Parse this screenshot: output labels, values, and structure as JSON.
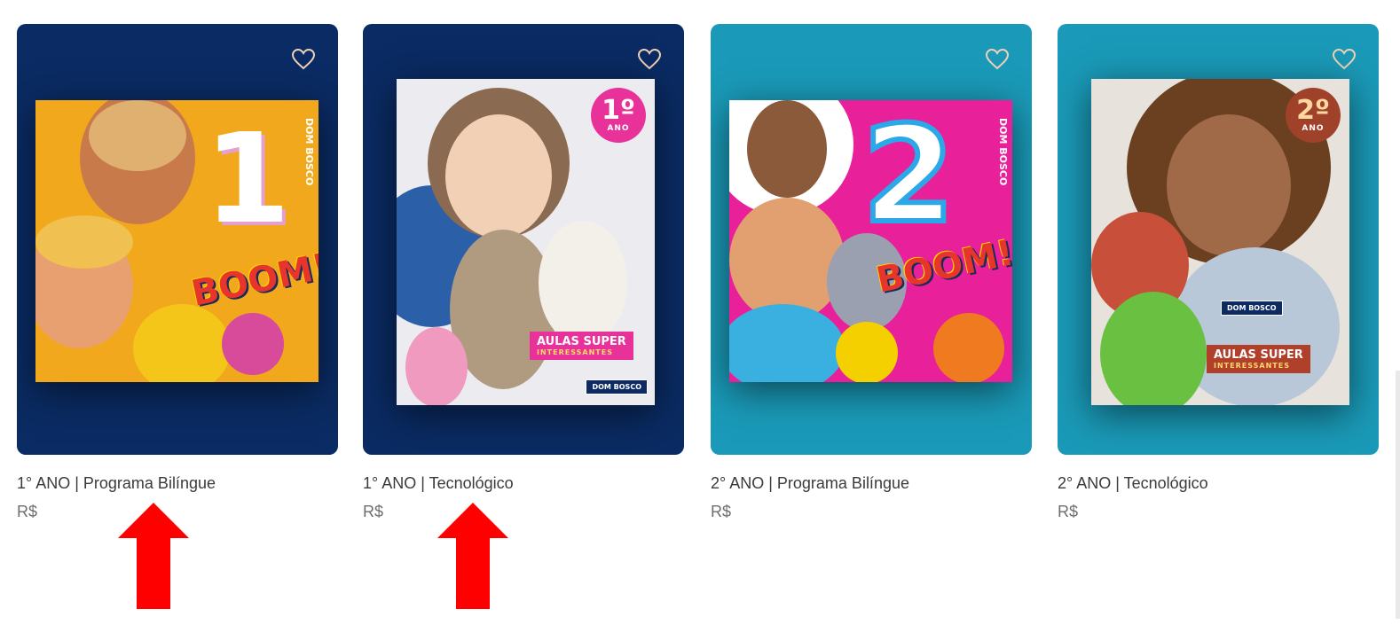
{
  "products": [
    {
      "title": "1° ANO | Programa Bilíngue",
      "price": "R$",
      "panel_color": "#0a2b63",
      "cover": {
        "bg": "#f2a81c",
        "number": "1",
        "boom": "BOOM!",
        "brand": "DOM BOSCO"
      }
    },
    {
      "title": "1° ANO | Tecnológico",
      "price": "R$",
      "panel_color": "#0a2b63",
      "cover": {
        "bg": "#ecebf0",
        "badge_num": "1º",
        "badge_text": "ANO",
        "ribbon": "AULAS SUPER",
        "ribbon_sub": "INTERESSANTES",
        "brand": "DOM BOSCO"
      }
    },
    {
      "title": "2° ANO | Programa Bilíngue",
      "price": "R$",
      "panel_color": "#1a9ab8",
      "cover": {
        "bg": "#e8219a",
        "number": "2",
        "boom": "BOOM!",
        "brand": "DOM BOSCO"
      }
    },
    {
      "title": "2° ANO | Tecnológico",
      "price": "R$",
      "panel_color": "#1a9ab8",
      "cover": {
        "bg": "#e7e2dc",
        "badge_num": "2º",
        "badge_text": "ANO",
        "ribbon": "AULAS SUPER",
        "ribbon_sub": "INTERESSANTES",
        "brand": "DOM BOSCO"
      }
    }
  ],
  "annotations": {
    "arrow_color": "#ff0000",
    "arrow_icon": "red-up-arrow-icon"
  },
  "icons": {
    "favorite": "heart-outline-icon"
  }
}
